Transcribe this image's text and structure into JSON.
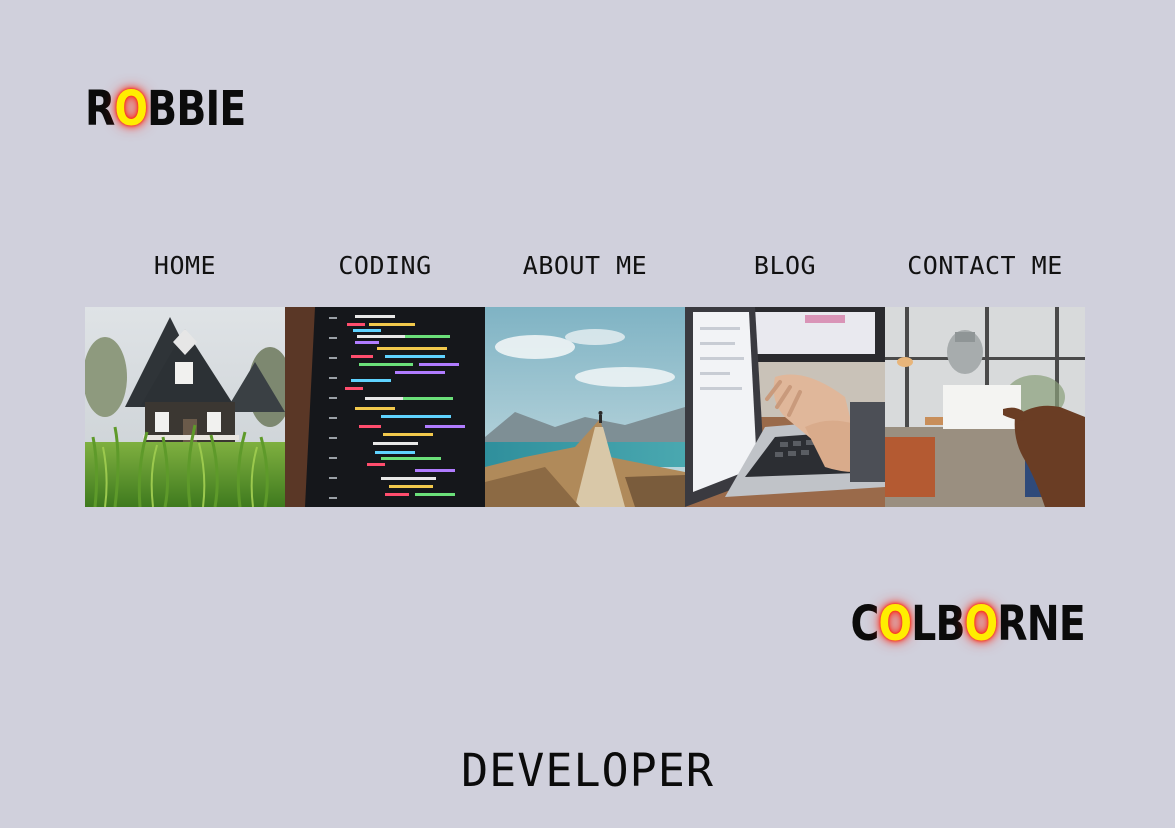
{
  "logo_first": {
    "letters": [
      "R",
      "O",
      "B",
      "B",
      "I",
      "E"
    ]
  },
  "logo_last": {
    "letters": [
      "C",
      "O",
      "L",
      "B",
      "O",
      "R",
      "N",
      "E"
    ]
  },
  "nav": {
    "items": [
      {
        "label": "HOME",
        "image_icon": "house-photo"
      },
      {
        "label": "CODING",
        "image_icon": "code-screen-photo"
      },
      {
        "label": "ABOUT ME",
        "image_icon": "mountain-hiker-photo"
      },
      {
        "label": "BLOG",
        "image_icon": "laptop-typing-photo"
      },
      {
        "label": "CONTACT ME",
        "image_icon": "business-card-photo"
      }
    ]
  },
  "tagline": "DEVELOPER",
  "colors": {
    "background": "#d0d0dc",
    "text": "#0b0b0b",
    "glow_fill": "#ffee00",
    "glow_halo": "#ff1a00"
  }
}
